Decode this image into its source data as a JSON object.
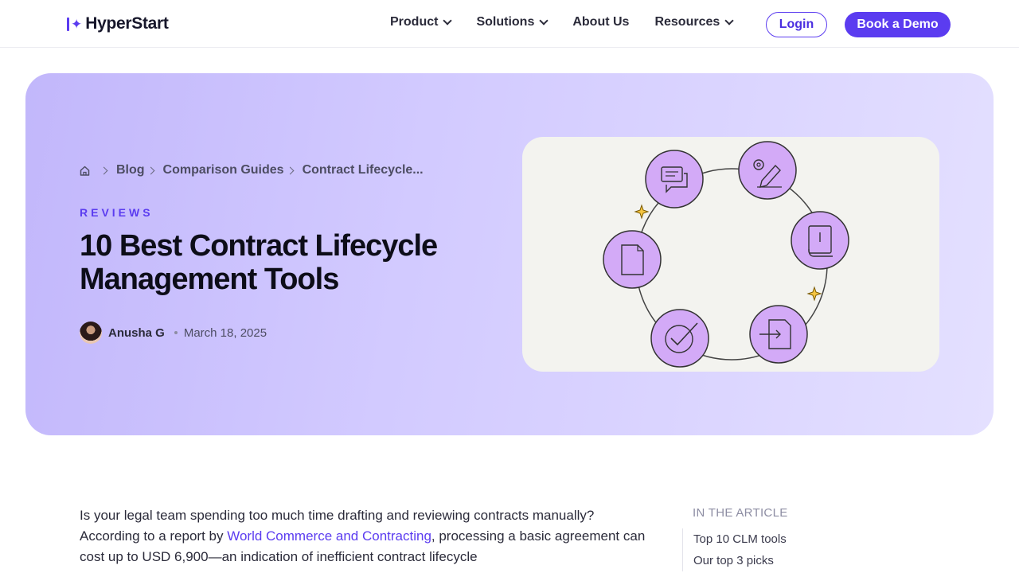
{
  "header": {
    "logo_text": "HyperStart",
    "nav": [
      {
        "label": "Product",
        "has_dropdown": true
      },
      {
        "label": "Solutions",
        "has_dropdown": true
      },
      {
        "label": "About Us",
        "has_dropdown": false
      },
      {
        "label": "Resources",
        "has_dropdown": true
      }
    ],
    "login_label": "Login",
    "demo_label": "Book a Demo"
  },
  "hero": {
    "breadcrumb": [
      "Blog",
      "Comparison Guides",
      "Contract Lifecycle..."
    ],
    "tag": "REVIEWS",
    "title_line1": "10 Best Contract Lifecycle",
    "title_line2": "Management Tools",
    "author": "Anusha G",
    "date": "March 18, 2025"
  },
  "illustration": {
    "icons": [
      "chat-icon",
      "gear-pencil-icon",
      "book-icon",
      "document-icon",
      "checkmark-icon",
      "document-arrow-icon"
    ],
    "sparkles": [
      "sparkle-icon",
      "sparkle-icon"
    ]
  },
  "article": {
    "intro_before": "Is your legal team spending too much time drafting and reviewing contracts manually? According to a report by ",
    "link_text": "World Commerce and Contracting",
    "intro_after": ", processing a basic agreement can cost up to USD 6,900—an indication of inefficient contract lifecycle"
  },
  "toc": {
    "heading": "IN THE ARTICLE",
    "items": [
      "Top 10 CLM tools",
      "Our top 3 picks"
    ]
  },
  "colors": {
    "brand": "#5b3cf0",
    "hero_bg_start": "#c2b7fb",
    "hero_bg_end": "#e4e0ff",
    "icon_fill": "#d3aaf7"
  }
}
